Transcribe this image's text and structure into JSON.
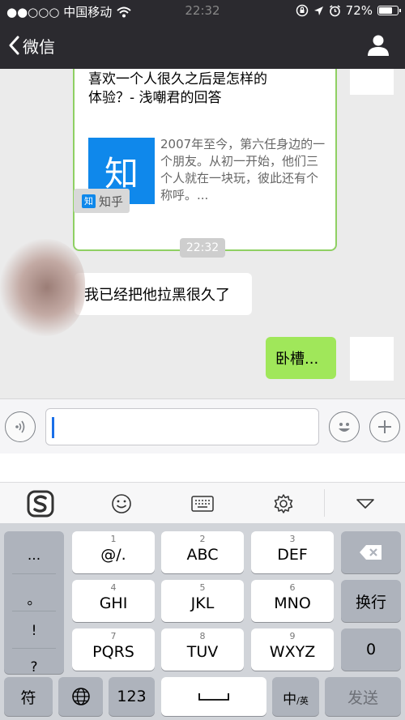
{
  "status_bar": {
    "carrier": "●●○○○ 中国移动",
    "time": "22:32",
    "battery": "72%"
  },
  "nav": {
    "back_label": "微信"
  },
  "chat": {
    "link_card": {
      "title_line1": "喜欢一个人很久之后是怎样的",
      "title_line2": "体验？- 浅嘲君的回答",
      "thumb_text": "知",
      "desc": "2007年至今，第六任身边的一个朋友。从初一开始，他们三个人就在一块玩，彼此还有个称呼。..."
    },
    "source": {
      "logo_text": "知",
      "label": "知乎"
    },
    "timestamp": "22:32",
    "incoming_message": "我已经把他拉黑很久了",
    "outgoing_message": "卧槽..."
  },
  "colors": {
    "nav_bg": "#2b2a2f",
    "outgoing_bubble": "#a0e75a",
    "card_border": "#8fd063",
    "zhihu_blue": "#0f88eb",
    "caret": "#1a6fe8"
  },
  "keyboard": {
    "punctuation": [
      "...",
      "。",
      "!",
      "?"
    ],
    "rows": [
      [
        {
          "num": "1",
          "main": "@/."
        },
        {
          "num": "2",
          "main": "ABC"
        },
        {
          "num": "3",
          "main": "DEF"
        }
      ],
      [
        {
          "num": "4",
          "main": "GHI"
        },
        {
          "num": "5",
          "main": "JKL"
        },
        {
          "num": "6",
          "main": "MNO"
        }
      ],
      [
        {
          "num": "7",
          "main": "PQRS"
        },
        {
          "num": "8",
          "main": "TUV"
        },
        {
          "num": "9",
          "main": "WXYZ"
        }
      ]
    ],
    "newline_label": "换行",
    "zero_label": "0",
    "symbol_label": "符",
    "num123_label": "123",
    "lang_main": "中",
    "lang_sub": "/英",
    "send_label": "发送"
  }
}
